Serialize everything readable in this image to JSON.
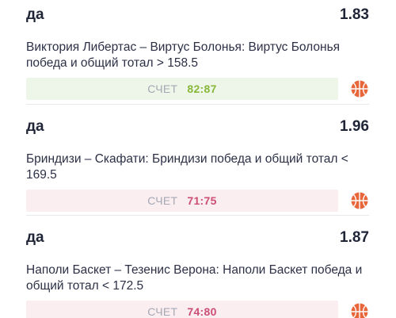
{
  "bets": [
    {
      "outcome": "да",
      "odds": "1.83",
      "description": "Виктория Либертас – Виртус Болонья: Виртус Болонья победа и общий тотал > 158.5",
      "score_label": "СЧЕТ",
      "score": "82:87",
      "status": "win",
      "sport_icon": "basketball-icon"
    },
    {
      "outcome": "да",
      "odds": "1.96",
      "description": "Бриндизи – Скафати: Бриндизи победа и общий тотал < 169.5",
      "score_label": "СЧЕТ",
      "score": "71:75",
      "status": "loss",
      "sport_icon": "basketball-icon"
    },
    {
      "outcome": "да",
      "odds": "1.87",
      "description": "Наполи Баскет – Тезенис Верона: Наполи Баскет победа и общий тотал < 172.5",
      "score_label": "СЧЕТ",
      "score": "74:80",
      "status": "loss",
      "sport_icon": "basketball-icon"
    }
  ],
  "colors": {
    "win_bg": "#eef6e9",
    "win_text": "#88b83a",
    "loss_bg": "#fbeef1",
    "loss_text": "#cc4f73",
    "ball": "#e8673a"
  }
}
